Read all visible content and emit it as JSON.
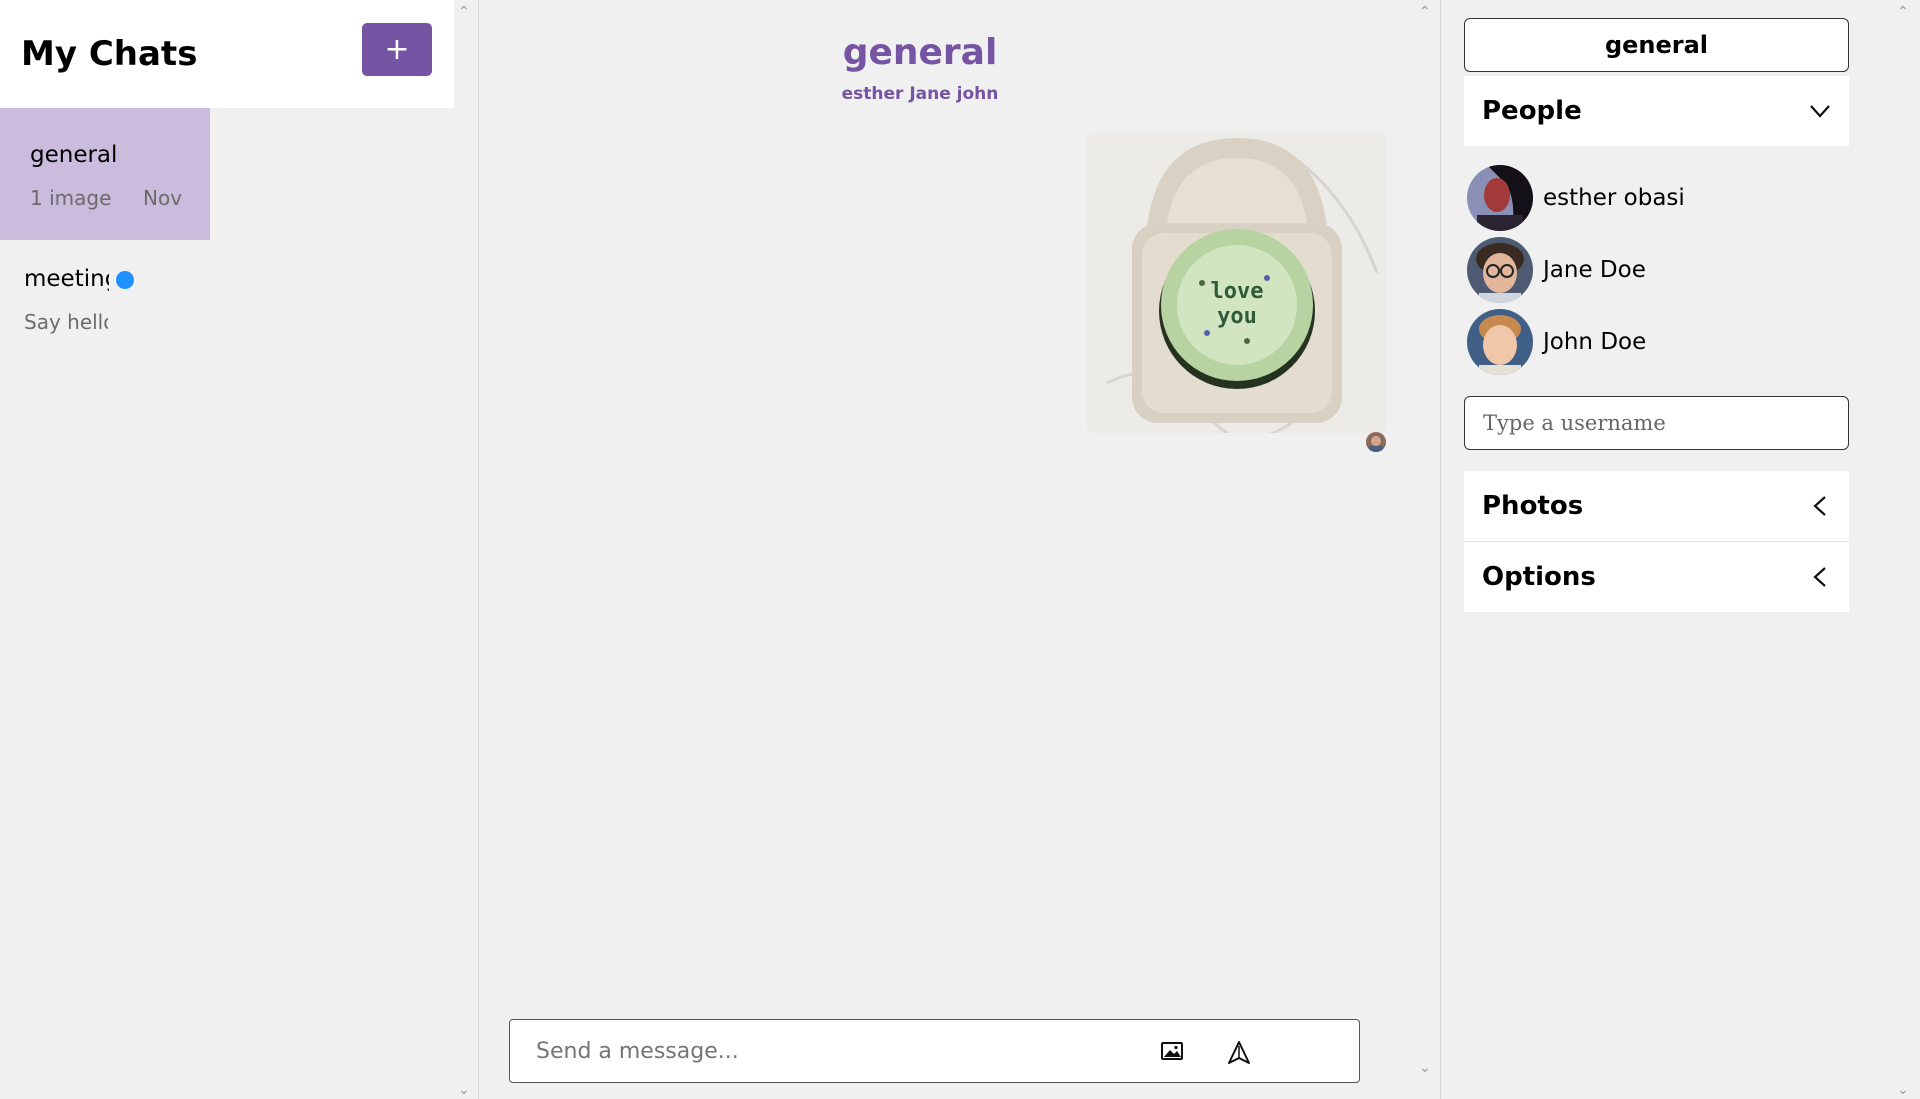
{
  "sidebar": {
    "title": "My Chats",
    "new_chat_label": "+",
    "chats": [
      {
        "name": "general",
        "preview": "1 image",
        "date": "Nov"
      },
      {
        "name": "meeting",
        "preview": "Say hello"
      }
    ]
  },
  "conversation": {
    "title": "general",
    "members": "esther Jane john",
    "composer_placeholder": "Send a message..."
  },
  "details": {
    "chat_title": "general",
    "people_label": "People",
    "people": [
      {
        "name": "esther obasi"
      },
      {
        "name": "Jane Doe"
      },
      {
        "name": "John Doe"
      }
    ],
    "username_placeholder": "Type a username",
    "photos_label": "Photos",
    "options_label": "Options"
  },
  "colors": {
    "accent": "#7554a3",
    "active_chat": "#cbbbdc",
    "unread": "#1e90ff",
    "online": "#33c433"
  }
}
